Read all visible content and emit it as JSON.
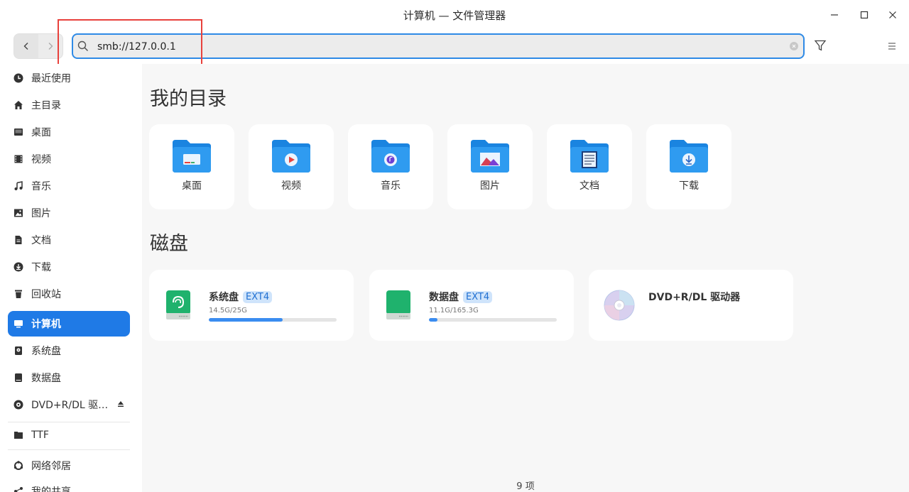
{
  "window": {
    "title": "计算机 — 文件管理器"
  },
  "toolbar": {
    "search_value": "smb://127.0.0.1"
  },
  "sidebar": {
    "items": [
      {
        "label": "最近使用",
        "icon": "clock-icon"
      },
      {
        "label": "主目录",
        "icon": "home-icon"
      },
      {
        "label": "桌面",
        "icon": "desktop-icon"
      },
      {
        "label": "视频",
        "icon": "video-icon"
      },
      {
        "label": "音乐",
        "icon": "music-icon"
      },
      {
        "label": "图片",
        "icon": "picture-icon"
      },
      {
        "label": "文档",
        "icon": "document-icon"
      },
      {
        "label": "下载",
        "icon": "download-icon"
      },
      {
        "label": "回收站",
        "icon": "trash-icon"
      },
      {
        "label": "计算机",
        "icon": "computer-icon",
        "active": true
      },
      {
        "label": "系统盘",
        "icon": "disk-icon"
      },
      {
        "label": "数据盘",
        "icon": "disk-icon"
      },
      {
        "label": "DVD+R/DL 驱…",
        "icon": "optical-disc-icon"
      },
      {
        "label": "TTF",
        "icon": "folder-icon"
      },
      {
        "label": "网络邻居",
        "icon": "network-icon"
      },
      {
        "label": "我的共享",
        "icon": "share-icon"
      }
    ]
  },
  "main": {
    "dirs_title": "我的目录",
    "folders": [
      {
        "label": "桌面",
        "icon": "desktop-folder-icon"
      },
      {
        "label": "视频",
        "icon": "video-folder-icon"
      },
      {
        "label": "音乐",
        "icon": "music-folder-icon"
      },
      {
        "label": "图片",
        "icon": "picture-folder-icon"
      },
      {
        "label": "文档",
        "icon": "document-folder-icon"
      },
      {
        "label": "下载",
        "icon": "download-folder-icon"
      }
    ],
    "disks_title": "磁盘",
    "disks": [
      {
        "name": "系统盘",
        "fs": "EXT4",
        "size": "14.5G/25G",
        "used_fraction": 0.58
      },
      {
        "name": "数据盘",
        "fs": "EXT4",
        "size": "11.1G/165.3G",
        "used_fraction": 0.067
      },
      {
        "name": "DVD+R/DL 驱动器"
      }
    ],
    "status": "9 项"
  },
  "colors": {
    "accent": "#1f7ae6",
    "highlight": "#e8413c"
  }
}
